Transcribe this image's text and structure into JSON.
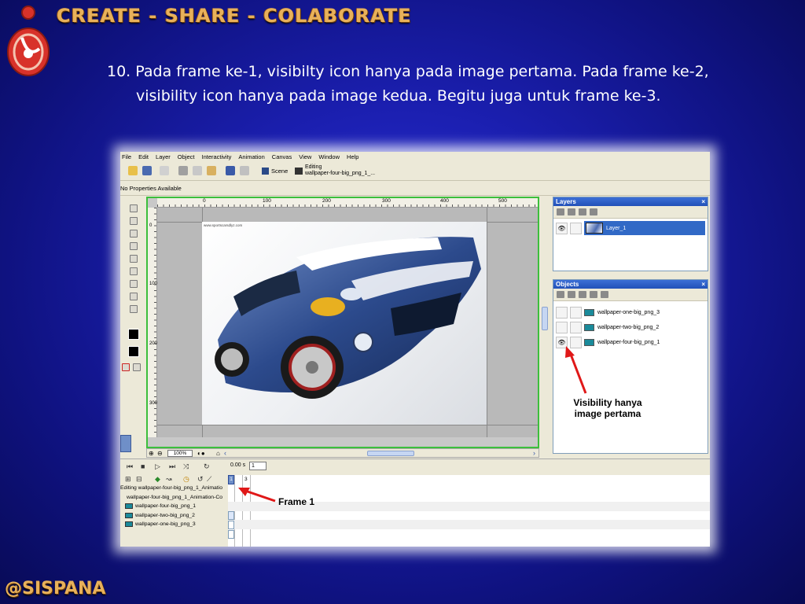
{
  "slide": {
    "header_title": "CREATE - SHARE - COLABORATE",
    "instruction": "10. Pada frame ke-1, visibilty icon hanya pada image pertama. Pada frame ke-2, visibility icon hanya pada image kedua. Begitu juga untuk frame ke-3.",
    "footer": "@SISPANA",
    "colors": {
      "header_text": "#e8b15a",
      "background": "#1b1fb0",
      "logo_red": "#d8322a"
    }
  },
  "app": {
    "menu": [
      "File",
      "Edit",
      "Layer",
      "Object",
      "Interactivity",
      "Animation",
      "Canvas",
      "View",
      "Window",
      "Help"
    ],
    "toolbar": {
      "scene_label": "Scene",
      "editing_label": "Editing",
      "editing_target": "wallpaper-four-big_png_1_..."
    },
    "properties_text": "No Properties Available",
    "canvas": {
      "ruler_labels": [
        "0",
        "100",
        "200",
        "300",
        "400",
        "500"
      ],
      "ruler_v_labels": [
        "0",
        "100",
        "200",
        "300"
      ],
      "photo_caption": "www.sportscarsdlyz.com",
      "zoom": "100%"
    },
    "layers_panel": {
      "title": "Layers",
      "layer_name": "Layer_1"
    },
    "objects_panel": {
      "title": "Objects",
      "items": [
        {
          "name": "wallpaper-one-big_png_3",
          "visible": false
        },
        {
          "name": "wallpaper-two-big_png_2",
          "visible": false
        },
        {
          "name": "wallpaper-four-big_png_1",
          "visible": true
        }
      ]
    },
    "timeline": {
      "time": "0.00 s",
      "frame_value": "1",
      "frame_current": "1",
      "frame_3": "3",
      "rows": [
        "Editing wallpaper-four-big_png_1_Animatio",
        "wallpaper-four-big_png_1_Animation-Co",
        "wallpaper-four-big_png_1",
        "wallpaper-two-big_png_2",
        "wallpaper-one-big_png_3"
      ]
    }
  },
  "annotations": {
    "visibility": "Visibility hanya\nimage pertama",
    "frame": "Frame 1",
    "arrow_color": "#e01818"
  }
}
